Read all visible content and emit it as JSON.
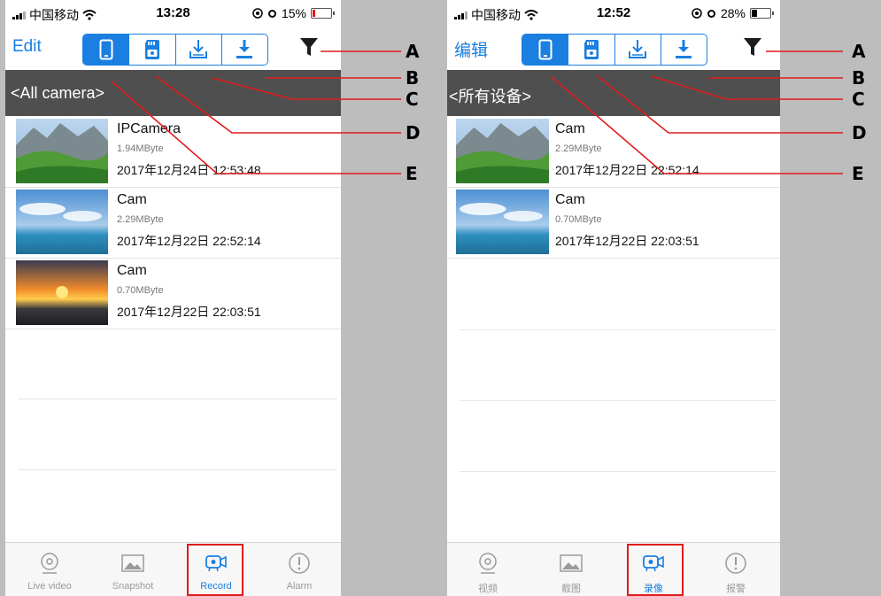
{
  "colors": {
    "accent": "#1a7fe0",
    "header_bg": "#4f4f4f",
    "callout": "#e01b1b",
    "page_bg": "#bdbdbd"
  },
  "left_phone": {
    "status": {
      "carrier": "中国移动",
      "time": "13:28",
      "battery": "15%",
      "battery_level": 0.15
    },
    "toolbar": {
      "edit_label": "Edit",
      "segments": [
        "phone-icon",
        "sd-card-icon",
        "download-to-device-icon",
        "download-icon"
      ],
      "active_segment": 0,
      "filter_icon": "funnel-icon"
    },
    "camera_header": "<All camera>",
    "records": [
      {
        "name": "IPCamera",
        "size": "1.94MByte",
        "date": "2017年12月24日 12:53:48",
        "thumb": "mountain-meadow"
      },
      {
        "name": "Cam",
        "size": "2.29MByte",
        "date": "2017年12月22日 22:52:14",
        "thumb": "beach-sky"
      },
      {
        "name": "Cam",
        "size": "0.70MByte",
        "date": "2017年12月22日 22:03:51",
        "thumb": "sunset-sea"
      }
    ],
    "tabs": [
      {
        "label": "Live video",
        "icon": "live-video-icon"
      },
      {
        "label": "Snapshot",
        "icon": "snapshot-icon"
      },
      {
        "label": "Record",
        "icon": "record-icon"
      },
      {
        "label": "Alarm",
        "icon": "alarm-icon"
      }
    ],
    "active_tab": 2
  },
  "right_phone": {
    "status": {
      "carrier": "中国移动",
      "time": "12:52",
      "battery": "28%",
      "battery_level": 0.28
    },
    "toolbar": {
      "edit_label": "编辑",
      "segments": [
        "phone-icon",
        "sd-card-icon",
        "download-to-device-icon",
        "download-icon"
      ],
      "active_segment": 0,
      "filter_icon": "funnel-icon"
    },
    "camera_header": "<所有设备>",
    "records": [
      {
        "name": "Cam",
        "size": "2.29MByte",
        "date": "2017年12月22日 22:52:14",
        "thumb": "mountain-meadow"
      },
      {
        "name": "Cam",
        "size": "0.70MByte",
        "date": "2017年12月22日 22:03:51",
        "thumb": "beach-sky"
      }
    ],
    "tabs": [
      {
        "label": "视频",
        "icon": "live-video-icon"
      },
      {
        "label": "截图",
        "icon": "snapshot-icon"
      },
      {
        "label": "录像",
        "icon": "record-icon"
      },
      {
        "label": "报警",
        "icon": "alarm-icon"
      }
    ],
    "active_tab": 2
  },
  "callouts": [
    "A",
    "B",
    "C",
    "D",
    "E"
  ]
}
